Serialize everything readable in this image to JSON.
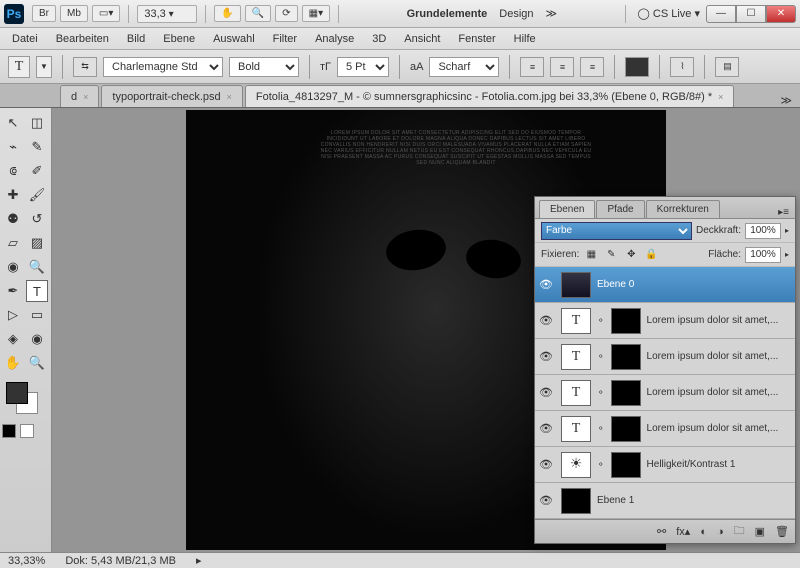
{
  "titlebar": {
    "ps": "Ps",
    "br": "Br",
    "mb": "Mb",
    "zoom": "33,3",
    "grundelemente": "Grundelemente",
    "design": "Design",
    "cslive": "CS Live"
  },
  "menu": [
    "Datei",
    "Bearbeiten",
    "Bild",
    "Ebene",
    "Auswahl",
    "Filter",
    "Analyse",
    "3D",
    "Ansicht",
    "Fenster",
    "Hilfe"
  ],
  "optbar": {
    "font": "Charlemagne Std",
    "weight": "Bold",
    "size": "5 Pt",
    "aa_label": "aA",
    "aa": "Scharf"
  },
  "tabs": {
    "left": "d",
    "t1": "typoportrait-check.psd",
    "t2": "Fotolia_4813297_M - © sumnersgraphicsinc - Fotolia.com.jpg bei 33,3% (Ebene 0, RGB/8#) *"
  },
  "panel": {
    "tabs": [
      "Ebenen",
      "Pfade",
      "Korrekturen"
    ],
    "blend": "Farbe",
    "opacity_label": "Deckkraft:",
    "opacity": "100%",
    "lock_label": "Fixieren:",
    "fill_label": "Fläche:",
    "fill": "100%",
    "layers": [
      {
        "name": "Ebene 0",
        "type": "img",
        "sel": true
      },
      {
        "name": "Lorem ipsum dolor sit amet,...",
        "type": "T",
        "mask": true
      },
      {
        "name": "Lorem ipsum dolor sit amet,...",
        "type": "T",
        "mask": true
      },
      {
        "name": "Lorem ipsum dolor sit amet,...",
        "type": "T",
        "mask": true
      },
      {
        "name": "Lorem ipsum dolor sit amet,...",
        "type": "T",
        "mask": true
      },
      {
        "name": "Helligkeit/Kontrast 1",
        "type": "adj",
        "mask": true
      },
      {
        "name": "Ebene 1",
        "type": "solid"
      }
    ]
  },
  "status": {
    "zoom": "33,33%",
    "doc": "Dok: 5,43 MB/21,3 MB"
  },
  "typo": "Lorem ipsum dolor sit amet consectetur adipiscing elit sed do eiusmod tempor incididunt ut labore et dolore magna aliqua donec dapibus lectus sit amet libero convallis non hendrerit nisi duis orci malesuada vivamus placerat nulla etiam sapien nec varius efficitur nullam netus eu est consequat rhoncus dapibus nec vehicula eu nisi praesent massa ac purus consequat suscipit ut egestas mollis massa sed tempus sed nunc aliquam blandit"
}
